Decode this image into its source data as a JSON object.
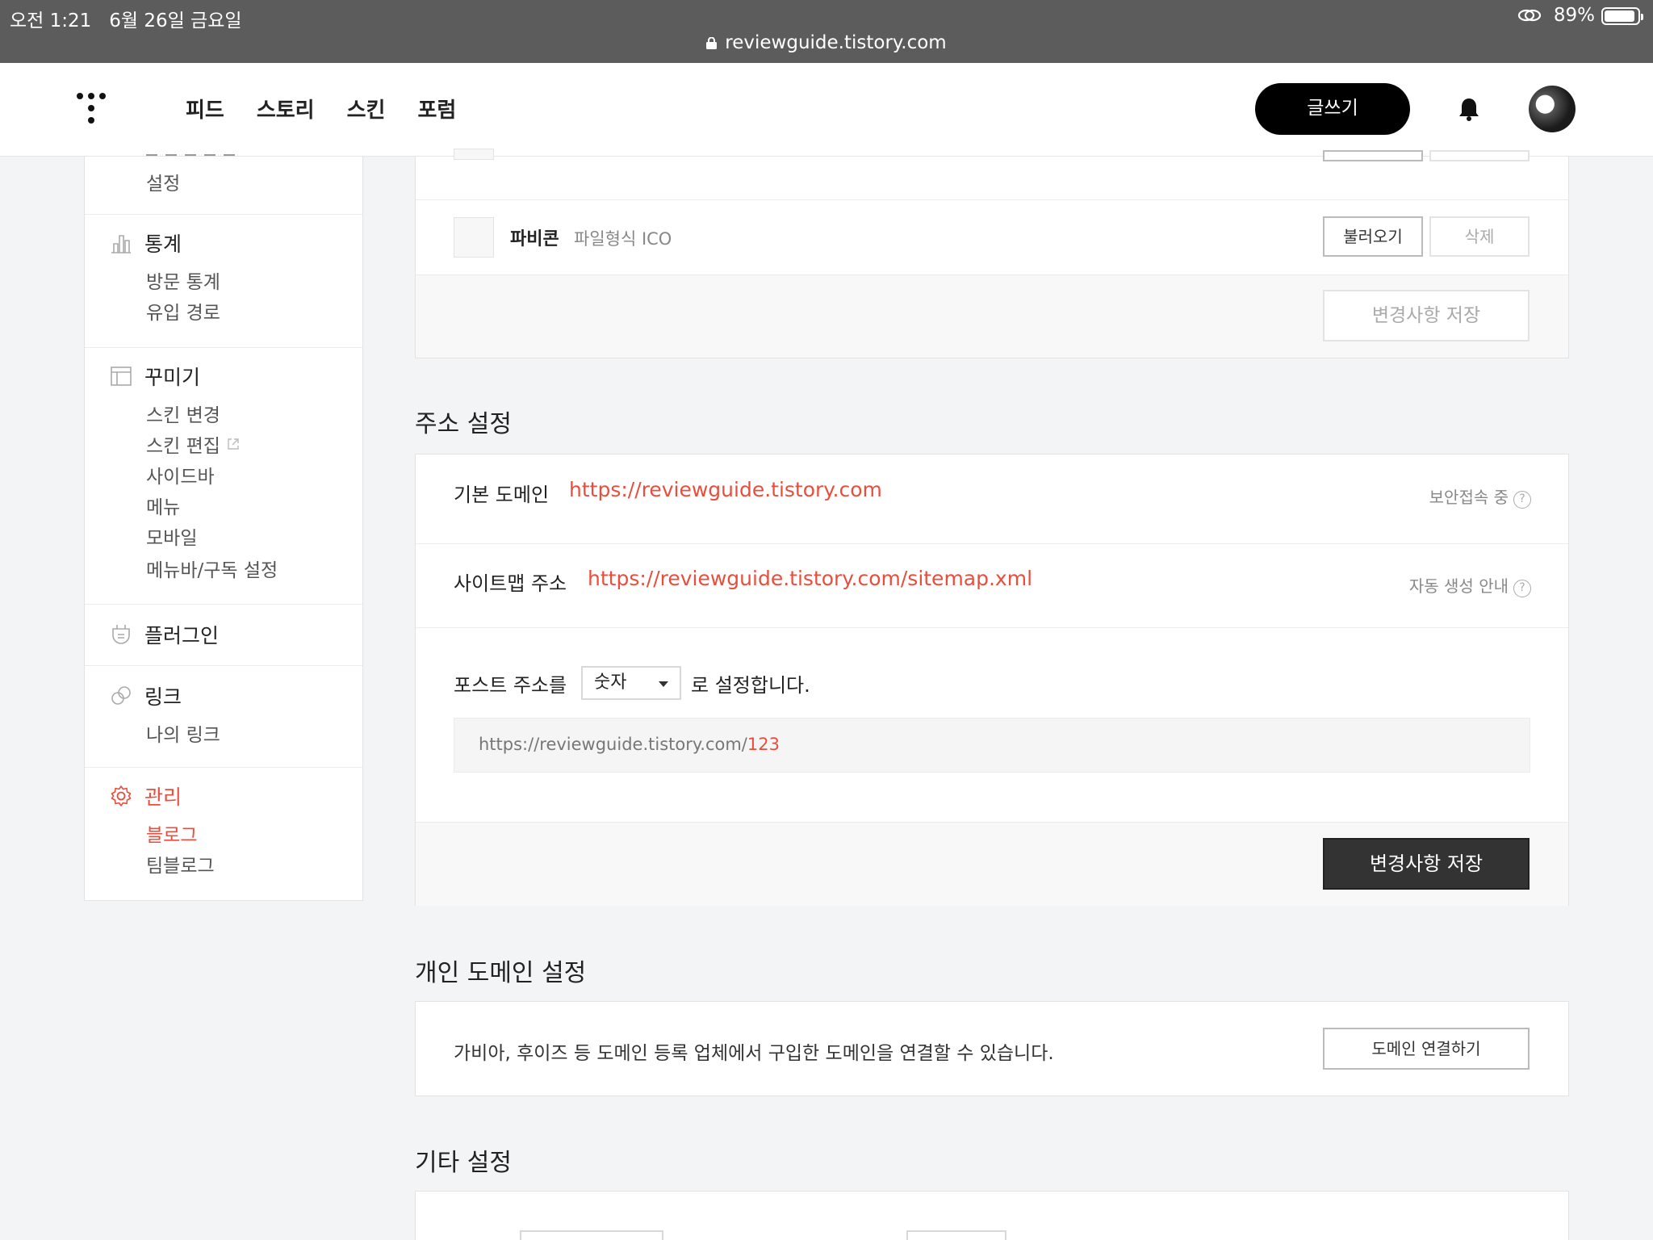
{
  "status_bar": {
    "time": "오전 1:21",
    "date": "6월 26일 금요일",
    "battery": "89%",
    "url": "reviewguide.tistory.com"
  },
  "header": {
    "nav": [
      "피드",
      "스토리",
      "스킨",
      "포럼"
    ],
    "write_label": "글쓰기"
  },
  "sidebar": {
    "partial_top_link": "설정",
    "stats": {
      "title": "통계",
      "links": [
        "방문 통계",
        "유입 경로"
      ]
    },
    "decorate": {
      "title": "꾸미기",
      "links": [
        "스킨 변경",
        "스킨 편집",
        "사이드바",
        "메뉴",
        "모바일",
        "메뉴바/구독 설정"
      ]
    },
    "plugin": {
      "title": "플러그인"
    },
    "link": {
      "title": "링크",
      "links": [
        "나의 링크"
      ]
    },
    "manage": {
      "title": "관리",
      "links": [
        "블로그",
        "팀블로그"
      ]
    }
  },
  "favicon_card": {
    "label": "파비콘",
    "format": "파일형식 ICO",
    "load_button": "불러오기",
    "delete_button": "삭제",
    "save_button": "변경사항 저장"
  },
  "address": {
    "title": "주소 설정",
    "domain_label": "기본 도메인",
    "domain_url": "https://reviewguide.tistory.com",
    "secure_text": "보안접속 중",
    "sitemap_label": "사이트맵 주소",
    "sitemap_url": "https://reviewguide.tistory.com/sitemap.xml",
    "sitemap_info": "자동 생성 안내",
    "post_prefix": "포스트 주소를",
    "post_select": "숫자",
    "post_suffix": "로 설정합니다.",
    "preview_base": "https://reviewguide.tistory.com/",
    "preview_num": "123",
    "save_button": "변경사항 저장"
  },
  "custom_domain": {
    "title": "개인 도메인 설정",
    "desc": "가비아, 후이즈 등 도메인 등록 업체에서 구입한 도메인을 연결할 수 있습니다.",
    "button": "도메인 연결하기"
  },
  "etc": {
    "title": "기타 설정"
  },
  "colors": {
    "accent": "#e94e3c",
    "dark_button": "#333333"
  }
}
